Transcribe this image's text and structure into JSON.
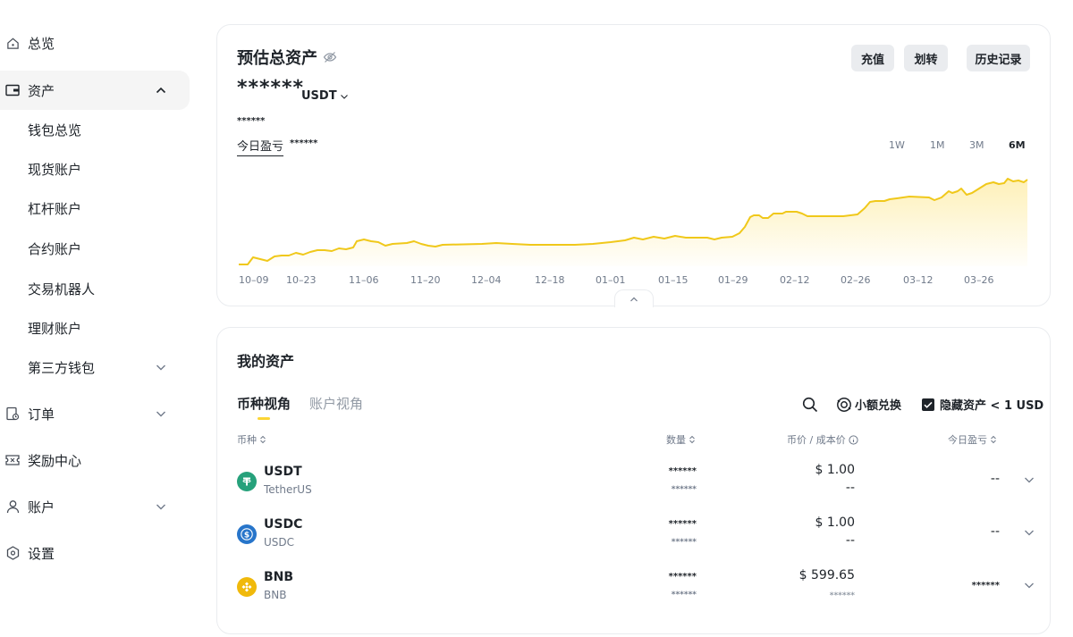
{
  "sidebar": {
    "items": [
      {
        "label": "总览",
        "icon": "home-icon"
      },
      {
        "label": "资产",
        "icon": "wallet-icon"
      },
      {
        "label": "订单",
        "icon": "orders-icon"
      },
      {
        "label": "奖励中心",
        "icon": "reward-icon"
      },
      {
        "label": "账户",
        "icon": "user-icon"
      },
      {
        "label": "设置",
        "icon": "settings-icon"
      }
    ],
    "asset_sub": [
      {
        "label": "钱包总览"
      },
      {
        "label": "现货账户"
      },
      {
        "label": "杠杆账户"
      },
      {
        "label": "合约账户"
      },
      {
        "label": "交易机器人"
      },
      {
        "label": "理财账户"
      },
      {
        "label": "第三方钱包"
      }
    ]
  },
  "overview": {
    "title": "预估总资产",
    "balance": "******",
    "currency": "USDT",
    "balance_sub": "******",
    "pnl_label": "今日盈亏",
    "pnl_value": "******",
    "buttons": {
      "deposit": "充值",
      "transfer": "划转",
      "history": "历史记录"
    },
    "ranges": [
      "1W",
      "1M",
      "3M",
      "6M"
    ],
    "active_range": "6M"
  },
  "chart_data": {
    "type": "area",
    "x_ticks": [
      "10–09",
      "10–23",
      "11–06",
      "11–20",
      "12–04",
      "12–18",
      "01–01",
      "01–15",
      "01–29",
      "02–12",
      "02–26",
      "03–12",
      "03–26"
    ],
    "line_color": "#f0c81a",
    "y_axis_labels": false,
    "grid": false
  },
  "assets": {
    "title": "我的资产",
    "tabs": [
      "币种视角",
      "账户视角"
    ],
    "small_convert": "小额兑换",
    "hide_small": "隐藏资产 < 1 USD",
    "columns": {
      "coin": "币种",
      "qty": "数量",
      "price": "币价 / 成本价",
      "pnl": "今日盈亏"
    },
    "rows": [
      {
        "symbol": "USDT",
        "name": "TetherUS",
        "qty": "******",
        "qty_sub": "******",
        "price": "$ 1.00",
        "cost": "--",
        "pnl": "--",
        "color": "#26a17b"
      },
      {
        "symbol": "USDC",
        "name": "USDC",
        "qty": "******",
        "qty_sub": "******",
        "price": "$ 1.00",
        "cost": "--",
        "pnl": "--",
        "color": "#2775ca"
      },
      {
        "symbol": "BNB",
        "name": "BNB",
        "qty": "******",
        "qty_sub": "******",
        "price": "$ 599.65",
        "cost": "******",
        "pnl": "******",
        "color": "#f0b90b"
      }
    ]
  }
}
